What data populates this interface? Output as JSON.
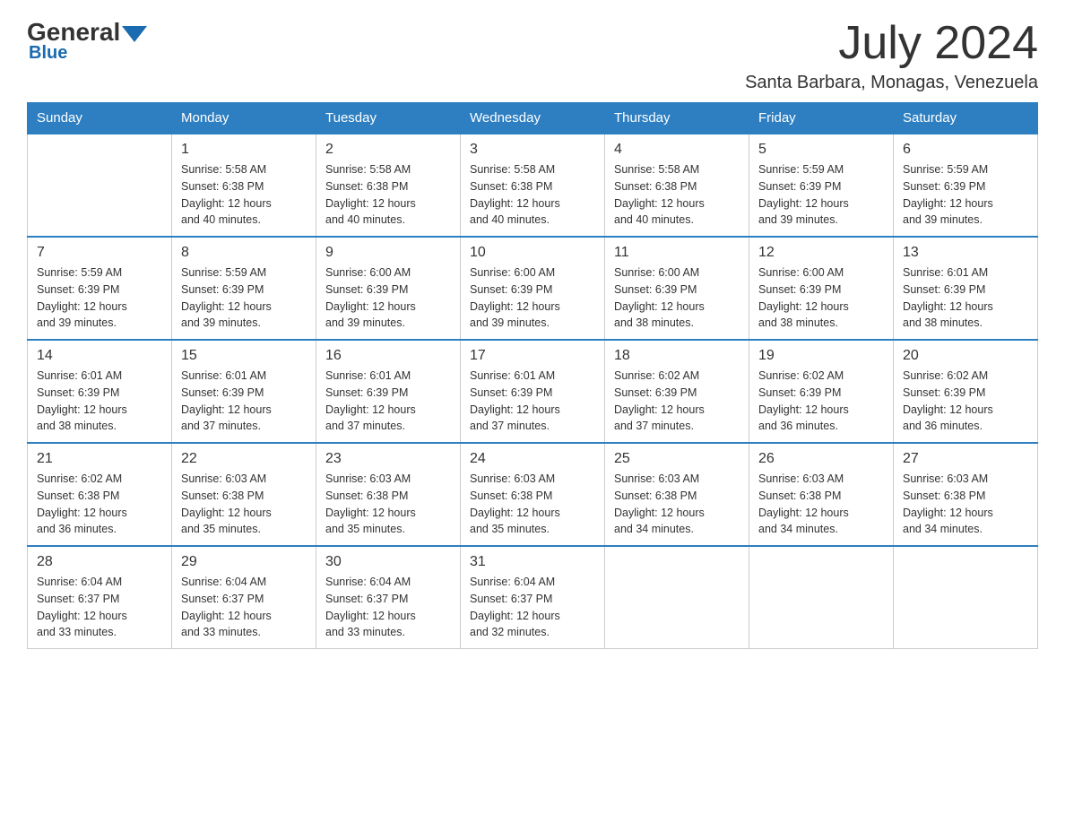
{
  "header": {
    "logo": {
      "general": "General",
      "triangle": "",
      "blue": "Blue"
    },
    "title": "July 2024",
    "location": "Santa Barbara, Monagas, Venezuela"
  },
  "calendar": {
    "days_of_week": [
      "Sunday",
      "Monday",
      "Tuesday",
      "Wednesday",
      "Thursday",
      "Friday",
      "Saturday"
    ],
    "weeks": [
      [
        {
          "day": "",
          "info": ""
        },
        {
          "day": "1",
          "info": "Sunrise: 5:58 AM\nSunset: 6:38 PM\nDaylight: 12 hours\nand 40 minutes."
        },
        {
          "day": "2",
          "info": "Sunrise: 5:58 AM\nSunset: 6:38 PM\nDaylight: 12 hours\nand 40 minutes."
        },
        {
          "day": "3",
          "info": "Sunrise: 5:58 AM\nSunset: 6:38 PM\nDaylight: 12 hours\nand 40 minutes."
        },
        {
          "day": "4",
          "info": "Sunrise: 5:58 AM\nSunset: 6:38 PM\nDaylight: 12 hours\nand 40 minutes."
        },
        {
          "day": "5",
          "info": "Sunrise: 5:59 AM\nSunset: 6:39 PM\nDaylight: 12 hours\nand 39 minutes."
        },
        {
          "day": "6",
          "info": "Sunrise: 5:59 AM\nSunset: 6:39 PM\nDaylight: 12 hours\nand 39 minutes."
        }
      ],
      [
        {
          "day": "7",
          "info": "Sunrise: 5:59 AM\nSunset: 6:39 PM\nDaylight: 12 hours\nand 39 minutes."
        },
        {
          "day": "8",
          "info": "Sunrise: 5:59 AM\nSunset: 6:39 PM\nDaylight: 12 hours\nand 39 minutes."
        },
        {
          "day": "9",
          "info": "Sunrise: 6:00 AM\nSunset: 6:39 PM\nDaylight: 12 hours\nand 39 minutes."
        },
        {
          "day": "10",
          "info": "Sunrise: 6:00 AM\nSunset: 6:39 PM\nDaylight: 12 hours\nand 39 minutes."
        },
        {
          "day": "11",
          "info": "Sunrise: 6:00 AM\nSunset: 6:39 PM\nDaylight: 12 hours\nand 38 minutes."
        },
        {
          "day": "12",
          "info": "Sunrise: 6:00 AM\nSunset: 6:39 PM\nDaylight: 12 hours\nand 38 minutes."
        },
        {
          "day": "13",
          "info": "Sunrise: 6:01 AM\nSunset: 6:39 PM\nDaylight: 12 hours\nand 38 minutes."
        }
      ],
      [
        {
          "day": "14",
          "info": "Sunrise: 6:01 AM\nSunset: 6:39 PM\nDaylight: 12 hours\nand 38 minutes."
        },
        {
          "day": "15",
          "info": "Sunrise: 6:01 AM\nSunset: 6:39 PM\nDaylight: 12 hours\nand 37 minutes."
        },
        {
          "day": "16",
          "info": "Sunrise: 6:01 AM\nSunset: 6:39 PM\nDaylight: 12 hours\nand 37 minutes."
        },
        {
          "day": "17",
          "info": "Sunrise: 6:01 AM\nSunset: 6:39 PM\nDaylight: 12 hours\nand 37 minutes."
        },
        {
          "day": "18",
          "info": "Sunrise: 6:02 AM\nSunset: 6:39 PM\nDaylight: 12 hours\nand 37 minutes."
        },
        {
          "day": "19",
          "info": "Sunrise: 6:02 AM\nSunset: 6:39 PM\nDaylight: 12 hours\nand 36 minutes."
        },
        {
          "day": "20",
          "info": "Sunrise: 6:02 AM\nSunset: 6:39 PM\nDaylight: 12 hours\nand 36 minutes."
        }
      ],
      [
        {
          "day": "21",
          "info": "Sunrise: 6:02 AM\nSunset: 6:38 PM\nDaylight: 12 hours\nand 36 minutes."
        },
        {
          "day": "22",
          "info": "Sunrise: 6:03 AM\nSunset: 6:38 PM\nDaylight: 12 hours\nand 35 minutes."
        },
        {
          "day": "23",
          "info": "Sunrise: 6:03 AM\nSunset: 6:38 PM\nDaylight: 12 hours\nand 35 minutes."
        },
        {
          "day": "24",
          "info": "Sunrise: 6:03 AM\nSunset: 6:38 PM\nDaylight: 12 hours\nand 35 minutes."
        },
        {
          "day": "25",
          "info": "Sunrise: 6:03 AM\nSunset: 6:38 PM\nDaylight: 12 hours\nand 34 minutes."
        },
        {
          "day": "26",
          "info": "Sunrise: 6:03 AM\nSunset: 6:38 PM\nDaylight: 12 hours\nand 34 minutes."
        },
        {
          "day": "27",
          "info": "Sunrise: 6:03 AM\nSunset: 6:38 PM\nDaylight: 12 hours\nand 34 minutes."
        }
      ],
      [
        {
          "day": "28",
          "info": "Sunrise: 6:04 AM\nSunset: 6:37 PM\nDaylight: 12 hours\nand 33 minutes."
        },
        {
          "day": "29",
          "info": "Sunrise: 6:04 AM\nSunset: 6:37 PM\nDaylight: 12 hours\nand 33 minutes."
        },
        {
          "day": "30",
          "info": "Sunrise: 6:04 AM\nSunset: 6:37 PM\nDaylight: 12 hours\nand 33 minutes."
        },
        {
          "day": "31",
          "info": "Sunrise: 6:04 AM\nSunset: 6:37 PM\nDaylight: 12 hours\nand 32 minutes."
        },
        {
          "day": "",
          "info": ""
        },
        {
          "day": "",
          "info": ""
        },
        {
          "day": "",
          "info": ""
        }
      ]
    ]
  }
}
